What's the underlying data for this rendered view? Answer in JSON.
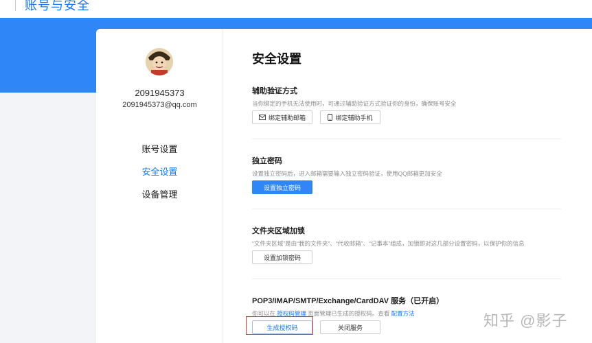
{
  "header": {
    "title": "账号与安全"
  },
  "user": {
    "id": "2091945373",
    "email": "2091945373@qq.com"
  },
  "nav": {
    "items": [
      {
        "label": "账号设置",
        "active": false
      },
      {
        "label": "安全设置",
        "active": true
      },
      {
        "label": "设备管理",
        "active": false
      }
    ]
  },
  "main": {
    "title": "安全设置",
    "sections": [
      {
        "title": "辅助验证方式",
        "desc": "当你绑定的手机无法使用时，可通过辅助验证方式验证你的身份，确保账号安全",
        "buttons": [
          {
            "label": "绑定辅助邮箱",
            "icon": "mail-icon"
          },
          {
            "label": "绑定辅助手机",
            "icon": "phone-icon"
          }
        ]
      },
      {
        "title": "独立密码",
        "desc": "设置独立密码后，进入邮箱需要输入独立密码验证，使用QQ邮箱更加安全",
        "buttons": [
          {
            "label": "设置独立密码"
          }
        ]
      },
      {
        "title": "文件夹区域加锁",
        "desc": "“文件夹区域”是由“我的文件夹”、“代收邮箱”、“记事本”组成，加锁即对这几部分设置密码，以保护你的信息",
        "buttons": [
          {
            "label": "设置加锁密码"
          }
        ]
      },
      {
        "title": "POP3/IMAP/SMTP/Exchange/CardDAV 服务（已开启）",
        "desc_parts": [
          "你可以在 ",
          "授权码管理",
          " 页面管理已生成的授权码。查看 ",
          "配置方法"
        ],
        "buttons": [
          {
            "label": "生成授权码"
          },
          {
            "label": "关闭服务"
          }
        ]
      }
    ]
  },
  "watermark": "知乎 @影子",
  "colors": {
    "accent": "#2f86f6",
    "link": "#1677ff",
    "highlight": "#d9363e",
    "background": "#f2f4f7"
  }
}
